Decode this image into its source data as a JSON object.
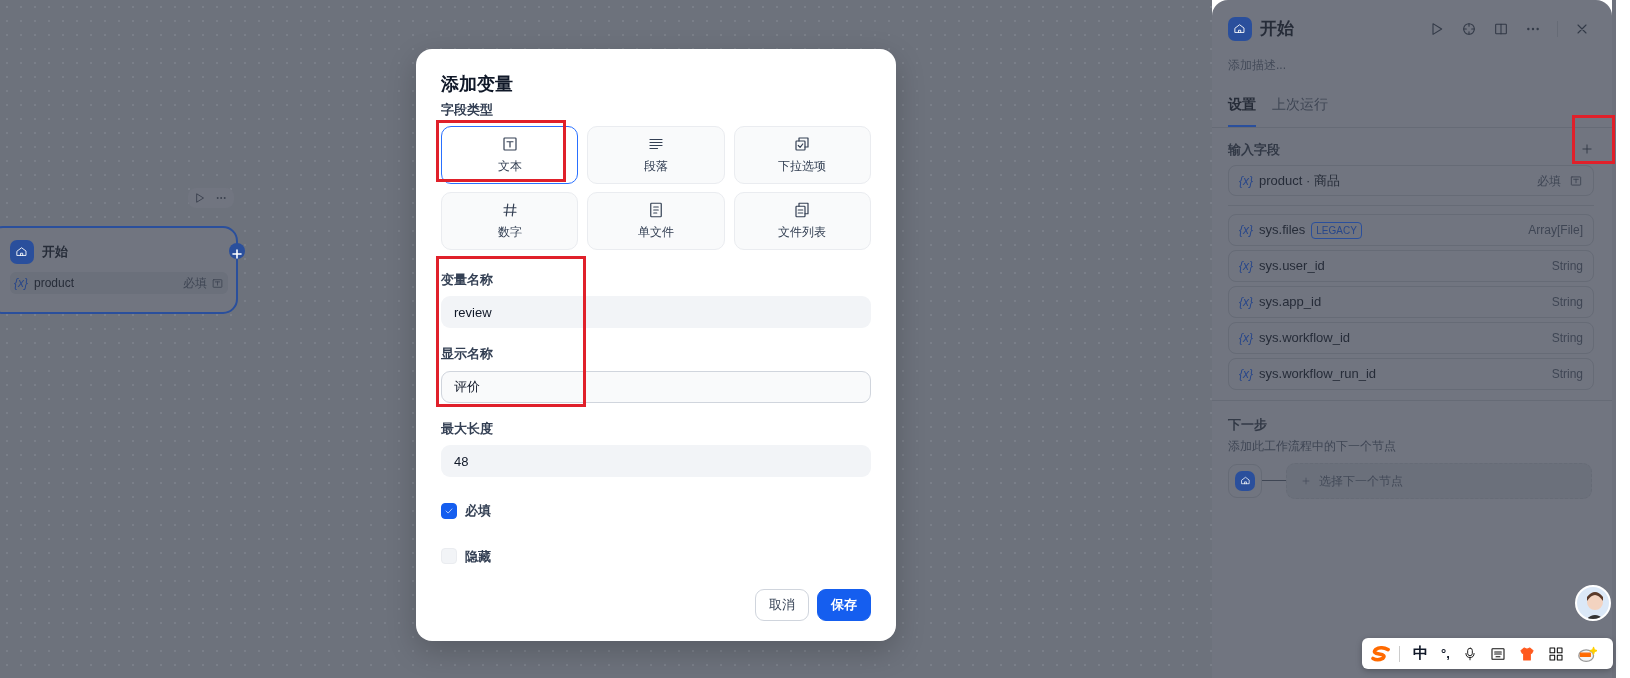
{
  "canvas_node": {
    "title": "开始",
    "fields": [
      {
        "icon": "{x}",
        "name": "product",
        "required": "必填"
      }
    ]
  },
  "dialog": {
    "title": "添加变量",
    "type_label": "字段类型",
    "field_types": [
      {
        "kind": "text",
        "label": "文本",
        "selected": true
      },
      {
        "kind": "paragraph",
        "label": "段落",
        "selected": false
      },
      {
        "kind": "select",
        "label": "下拉选项",
        "selected": false
      },
      {
        "kind": "number",
        "label": "数字",
        "selected": false
      },
      {
        "kind": "file",
        "label": "单文件",
        "selected": false
      },
      {
        "kind": "filelist",
        "label": "文件列表",
        "selected": false
      }
    ],
    "fields": [
      {
        "label": "变量名称",
        "value": "review",
        "focused": false
      },
      {
        "label": "显示名称",
        "value": "评价",
        "focused": true
      },
      {
        "label": "最大长度",
        "value": "48",
        "focused": false
      }
    ],
    "checkboxes": [
      {
        "label": "必填",
        "checked": true
      },
      {
        "label": "隐藏",
        "checked": false
      }
    ],
    "buttons": [
      {
        "kind": "secondary",
        "label": "取消"
      },
      {
        "kind": "primary",
        "label": "保存"
      }
    ]
  },
  "panel": {
    "title": "开始",
    "description_placeholder": "添加描述...",
    "tabs": [
      {
        "label": "设置",
        "selected": true
      },
      {
        "label": "上次运行",
        "selected": false
      }
    ],
    "input_fields_title": "输入字段",
    "input_fields": [
      {
        "icon": "{x}",
        "label": "product · 商品",
        "required": "必填"
      }
    ],
    "system_vars": [
      {
        "icon": "{x}",
        "name": "sys.files",
        "badge": "LEGACY",
        "type": "Array[File]"
      },
      {
        "icon": "{x}",
        "name": "sys.user_id",
        "type": "String"
      },
      {
        "icon": "{x}",
        "name": "sys.app_id",
        "type": "String"
      },
      {
        "icon": "{x}",
        "name": "sys.workflow_id",
        "type": "String"
      },
      {
        "icon": "{x}",
        "name": "sys.workflow_run_id",
        "type": "String"
      }
    ],
    "next_step": {
      "title": "下一步",
      "subtitle": "添加此工作流程中的下一个节点",
      "select_label": "选择下一个节点"
    }
  },
  "ime_bar": {
    "mode": "中",
    "punctuation": "°,"
  }
}
